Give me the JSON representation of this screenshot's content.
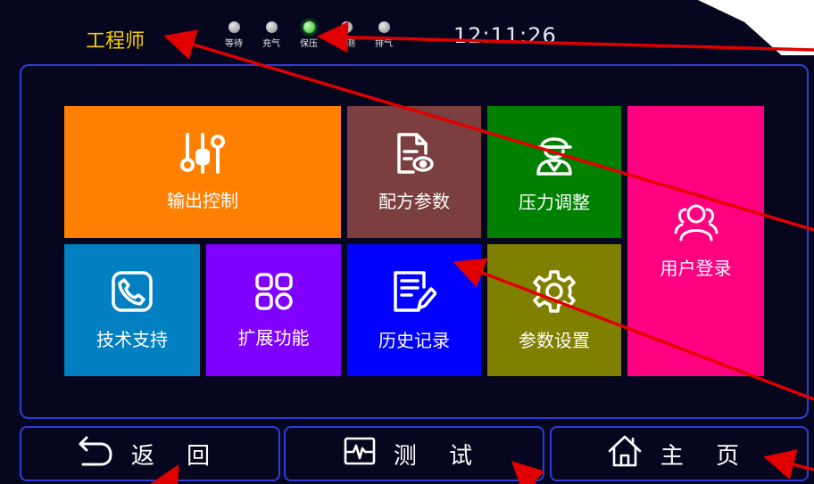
{
  "header": {
    "role": "工程师",
    "indicators": [
      {
        "label": "等待",
        "active": false
      },
      {
        "label": "充气",
        "active": false
      },
      {
        "label": "保压",
        "active": true
      },
      {
        "label": "检测",
        "active": false
      },
      {
        "label": "排气",
        "active": false
      }
    ],
    "time": "12:11:26"
  },
  "tiles": {
    "output_control": {
      "label": "输出控制",
      "color": "#ff8000",
      "icon": "sliders-icon"
    },
    "recipe_params": {
      "label": "配方参数",
      "color": "#7b3f3f",
      "icon": "document-view-icon"
    },
    "pressure_adjust": {
      "label": "压力调整",
      "color": "#008000",
      "icon": "engineer-icon"
    },
    "user_login": {
      "label": "用户登录",
      "color": "#ff0080",
      "icon": "users-icon"
    },
    "tech_support": {
      "label": "技术支持",
      "color": "#0080c0",
      "icon": "phone-icon"
    },
    "extensions": {
      "label": "扩展功能",
      "color": "#8000ff",
      "icon": "grid-icon"
    },
    "history": {
      "label": "历史记录",
      "color": "#0000ff",
      "icon": "notes-edit-icon"
    },
    "param_settings": {
      "label": "参数设置",
      "color": "#808000",
      "icon": "gear-icon"
    }
  },
  "nav": {
    "back_label": "返 回",
    "test_label": "测 试",
    "home_label": "主 页"
  },
  "colors": {
    "background": "#06061e",
    "border": "#2d3dd8",
    "role_text": "#f7d100",
    "annotation_arrow": "#e00000"
  }
}
